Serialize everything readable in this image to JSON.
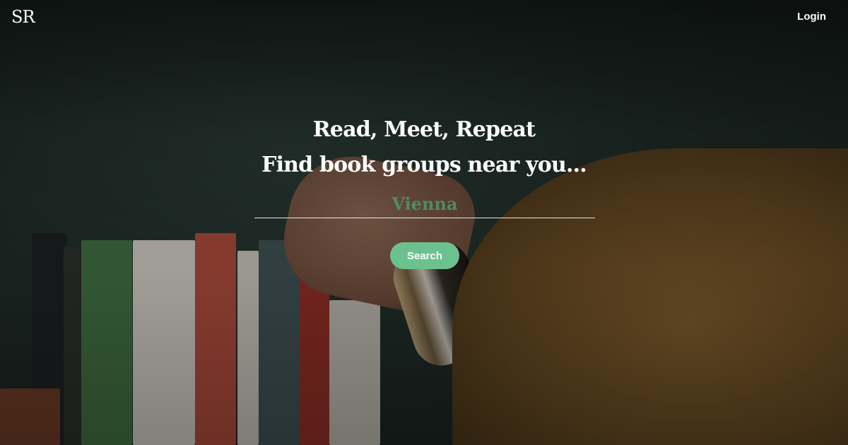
{
  "brand": {
    "logo_text": "SR"
  },
  "nav": {
    "login_label": "Login"
  },
  "hero": {
    "headline_line1": "Read, Meet, Repeat",
    "headline_line2": "Find book groups near you...",
    "location_value": "Vienna",
    "search_label": "Search"
  },
  "colors": {
    "accent_green": "#6cc28e",
    "input_text_green": "#4e8c63",
    "text_white": "#ffffff"
  }
}
